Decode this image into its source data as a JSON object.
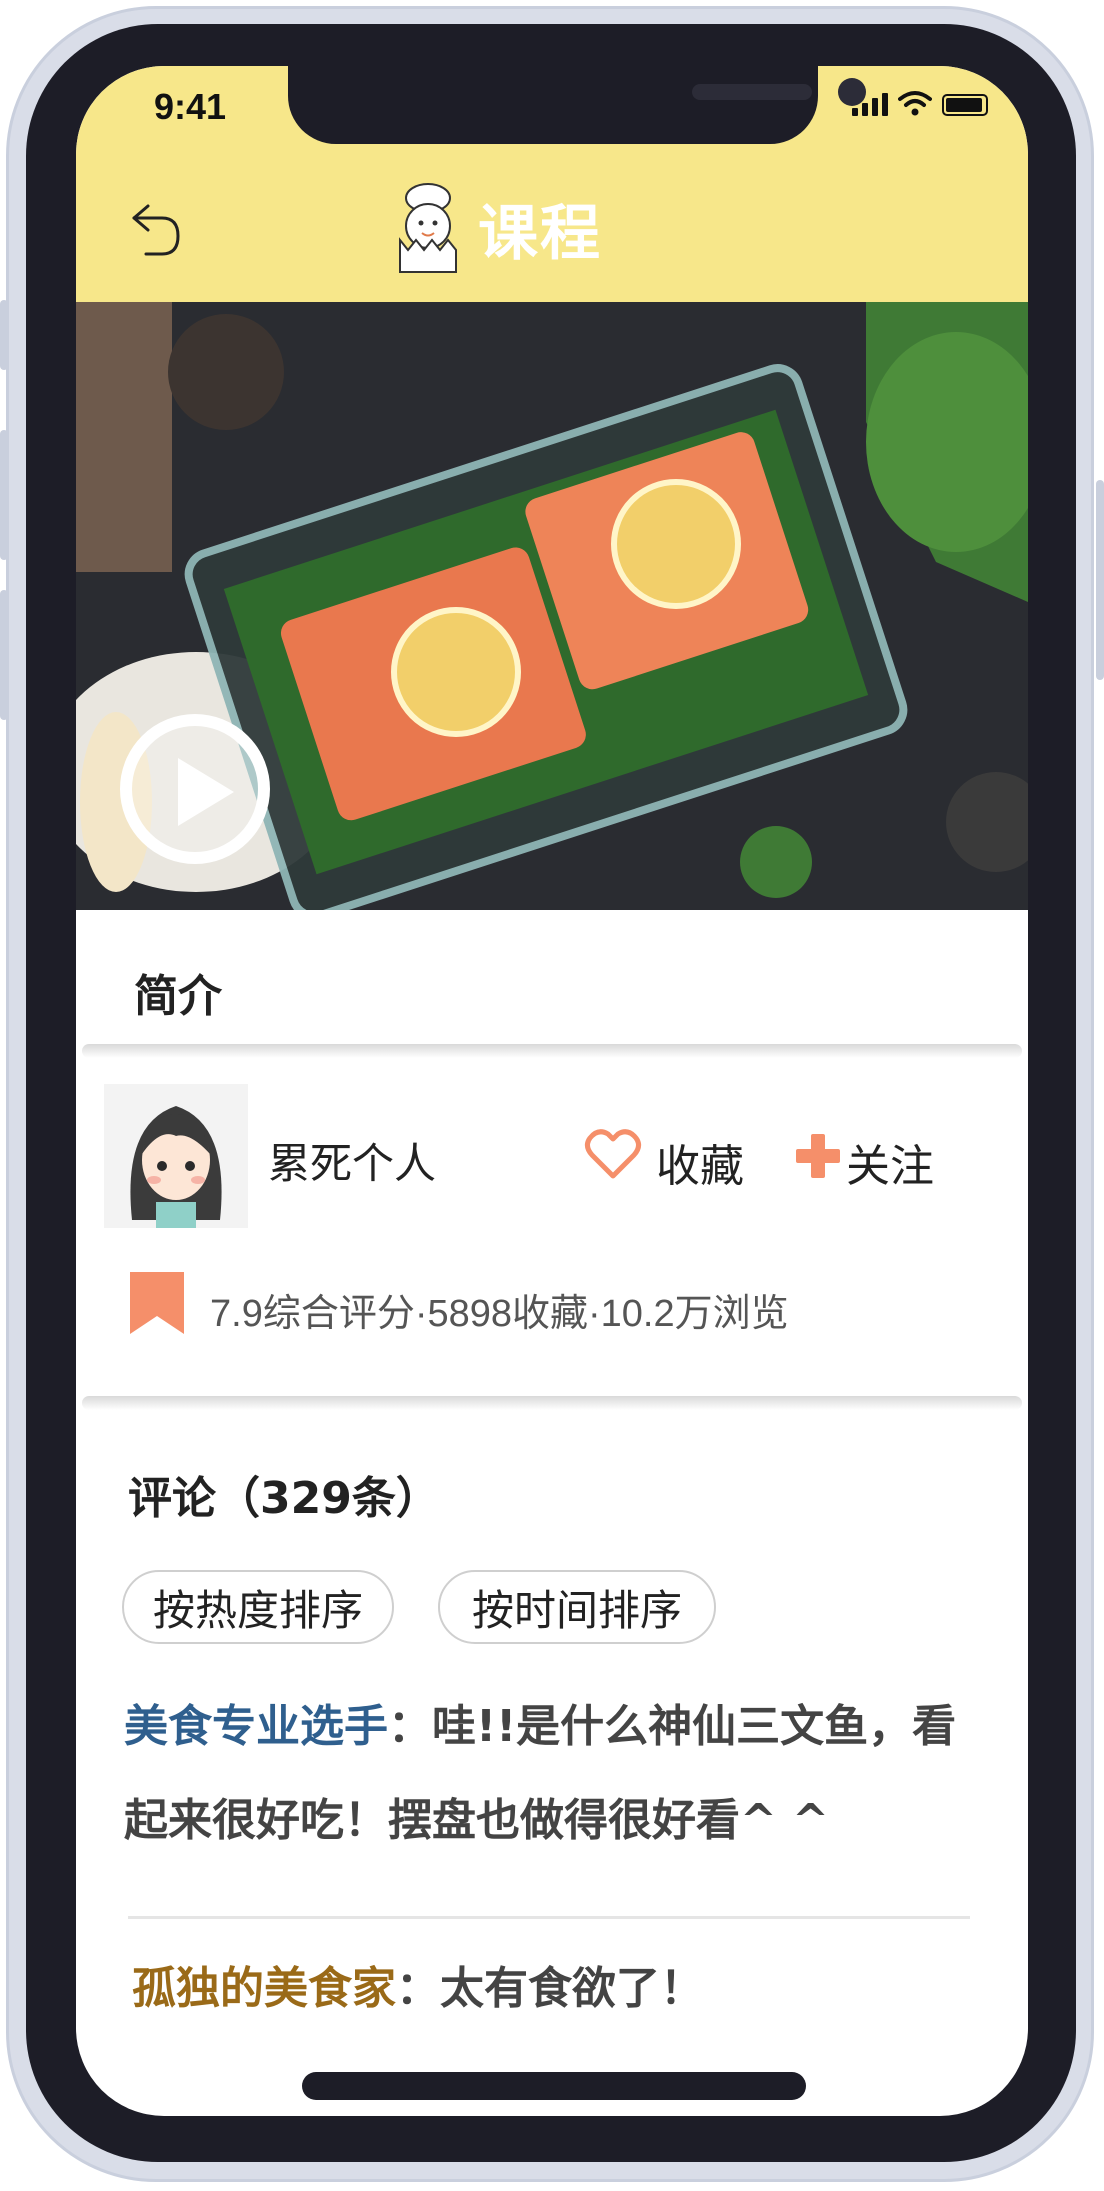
{
  "status_bar": {
    "time": "9:41"
  },
  "header": {
    "title": "课程"
  },
  "intro": {
    "section_title": "简介"
  },
  "author": {
    "name": "累死个人",
    "favorite_label": "收藏",
    "follow_label": "关注"
  },
  "stats": {
    "text": "7.9综合评分·5898收藏·10.2万浏览"
  },
  "comments": {
    "title": "评论（329条）",
    "sort_hot": "按热度排序",
    "sort_time": "按时间排序",
    "items": [
      {
        "user": "美食专业选手",
        "sep": "：",
        "text": "哇!!是什么神仙三文鱼，看起来很好吃！摆盘也做得很好看^ ^"
      },
      {
        "user": "孤独的美食家",
        "sep": "：",
        "text": "太有食欲了！"
      }
    ]
  },
  "colors": {
    "header_bg": "#f7e78a",
    "accent": "#f58f6a",
    "blue_user": "#2f5f8e",
    "gold_user": "#9a6a18"
  },
  "icons": [
    "back-arrow-icon",
    "chef-logo-icon",
    "play-icon",
    "heart-icon",
    "plus-icon",
    "bookmark-icon"
  ]
}
